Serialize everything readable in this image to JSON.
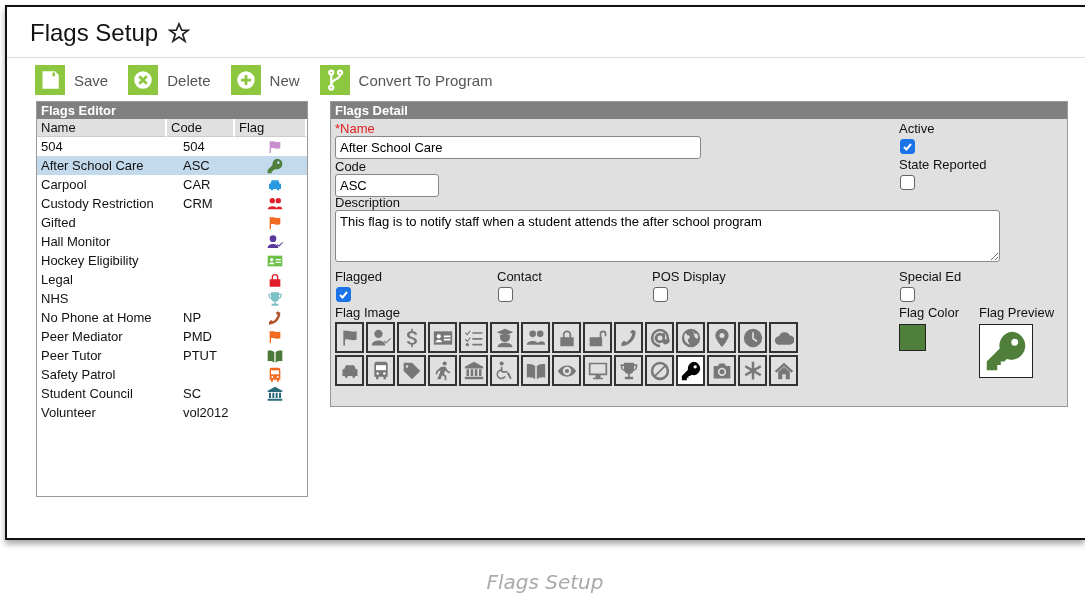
{
  "page_title": "Flags Setup",
  "toolbar": [
    {
      "label": "Save",
      "kind": "save"
    },
    {
      "label": "Delete",
      "kind": "delete"
    },
    {
      "label": "New",
      "kind": "new"
    },
    {
      "label": "Convert To Program",
      "kind": "branch"
    }
  ],
  "flags_editor": {
    "title": "Flags Editor",
    "columns": [
      "Name",
      "Code",
      "Flag"
    ],
    "rows": [
      {
        "name": "504",
        "code": "504",
        "kind": "flag",
        "color": "#c98fcf",
        "selected": false
      },
      {
        "name": "After School Care",
        "code": "ASC",
        "kind": "key",
        "color": "#4f7f3a",
        "selected": true
      },
      {
        "name": "Carpool",
        "code": "CAR",
        "kind": "car",
        "color": "#2a9be0",
        "selected": false
      },
      {
        "name": "Custody Restriction",
        "code": "CRM",
        "kind": "users",
        "color": "#e0202a",
        "selected": false
      },
      {
        "name": "Gifted",
        "kind": "flag",
        "color": "#f26b21",
        "selected": false
      },
      {
        "name": "Hall Monitor",
        "kind": "user-check",
        "color": "#5a3a9a",
        "selected": false
      },
      {
        "name": "Hockey Eligibility",
        "kind": "id-card",
        "color": "#6cc04a",
        "selected": false
      },
      {
        "name": "Legal",
        "kind": "lock",
        "color": "#e0202a",
        "selected": false
      },
      {
        "name": "NHS",
        "kind": "trophy",
        "color": "#7cc0c8",
        "selected": false
      },
      {
        "name": "No Phone at Home",
        "code": "NP",
        "kind": "phone",
        "color": "#b0522a",
        "selected": false
      },
      {
        "name": "Peer Mediator",
        "code": "PMD",
        "kind": "flag",
        "color": "#f26b21",
        "selected": false
      },
      {
        "name": "Peer Tutor",
        "code": "PTUT",
        "kind": "book",
        "color": "#4a7a3a",
        "selected": false
      },
      {
        "name": "Safety Patrol",
        "kind": "bus",
        "color": "#f26b21",
        "selected": false
      },
      {
        "name": "Student Council",
        "code": "SC",
        "kind": "bank",
        "color": "#2a6a7a",
        "selected": false
      },
      {
        "name": "Volunteer",
        "code": "vol2012",
        "selected": false
      }
    ]
  },
  "flags_detail": {
    "title": "Flags Detail",
    "name_label": "*Name",
    "name_value": "After School Care",
    "code_label": "Code",
    "code_value": "ASC",
    "description_label": "Description",
    "description_value": "This flag is to notify staff when a student attends the after school program",
    "active": {
      "label": "Active",
      "checked": true
    },
    "state_reported": {
      "label": "State Reported",
      "checked": false
    },
    "options": [
      {
        "label": "Flagged",
        "checked": true
      },
      {
        "label": "Contact",
        "checked": false
      },
      {
        "label": "POS Display",
        "checked": false
      },
      {
        "label": "Special Ed",
        "checked": false
      }
    ],
    "flag_image_label": "Flag Image",
    "flag_images": [
      {
        "kind": "flag",
        "selected": false
      },
      {
        "kind": "user-check",
        "selected": false
      },
      {
        "kind": "dollar",
        "selected": false
      },
      {
        "kind": "id-card",
        "selected": false
      },
      {
        "kind": "list",
        "selected": false
      },
      {
        "kind": "graduate",
        "selected": false
      },
      {
        "kind": "users",
        "selected": false
      },
      {
        "kind": "lock",
        "selected": false
      },
      {
        "kind": "unlock",
        "selected": false
      },
      {
        "kind": "phone",
        "selected": false
      },
      {
        "kind": "at",
        "selected": false
      },
      {
        "kind": "globe",
        "selected": false
      },
      {
        "kind": "pin",
        "selected": false
      },
      {
        "kind": "clock",
        "selected": false
      },
      {
        "kind": "cloud",
        "selected": false
      },
      {
        "kind": "car",
        "selected": false
      },
      {
        "kind": "bus",
        "selected": false
      },
      {
        "kind": "tag",
        "selected": false
      },
      {
        "kind": "runner",
        "selected": false
      },
      {
        "kind": "bank",
        "selected": false
      },
      {
        "kind": "wheelchair",
        "selected": false
      },
      {
        "kind": "book",
        "selected": false
      },
      {
        "kind": "eye",
        "selected": false
      },
      {
        "kind": "monitor",
        "selected": false
      },
      {
        "kind": "trophy",
        "selected": false
      },
      {
        "kind": "ban",
        "selected": false
      },
      {
        "kind": "key",
        "selected": true
      },
      {
        "kind": "camera",
        "selected": false
      },
      {
        "kind": "asterisk",
        "selected": false
      },
      {
        "kind": "home",
        "selected": false
      }
    ],
    "flag_color": {
      "label": "Flag Color",
      "color": "#4f7f3a"
    },
    "flag_preview_label": "Flag Preview"
  },
  "caption": "Flags Setup"
}
